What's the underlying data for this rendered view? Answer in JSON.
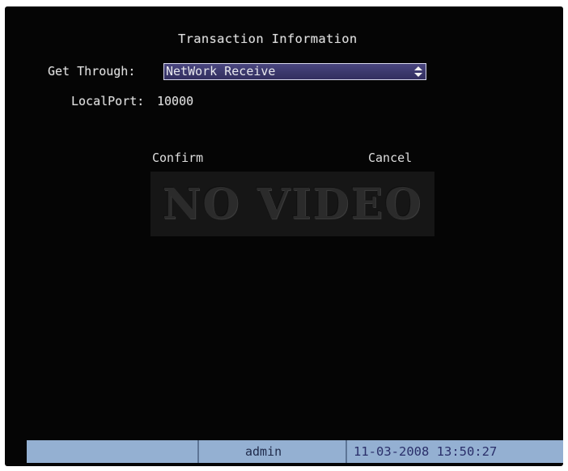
{
  "dialog": {
    "title": "Transaction Information",
    "get_through_label": "Get Through:",
    "get_through_value": "NetWork Receive",
    "local_port_label": "LocalPort:",
    "local_port_value": "10000",
    "confirm_label": "Confirm",
    "cancel_label": "Cancel"
  },
  "overlay": {
    "no_video_text": "NO VIDEO"
  },
  "status_bar": {
    "user": "admin",
    "datetime": "11-03-2008 13:50:27"
  },
  "icons": {
    "select_arrow": "up-down-arrow-icon"
  },
  "colors": {
    "background": "#050505",
    "select_bg": "#3b386c",
    "status_bar": "#94b0d2",
    "text": "#dedede"
  }
}
